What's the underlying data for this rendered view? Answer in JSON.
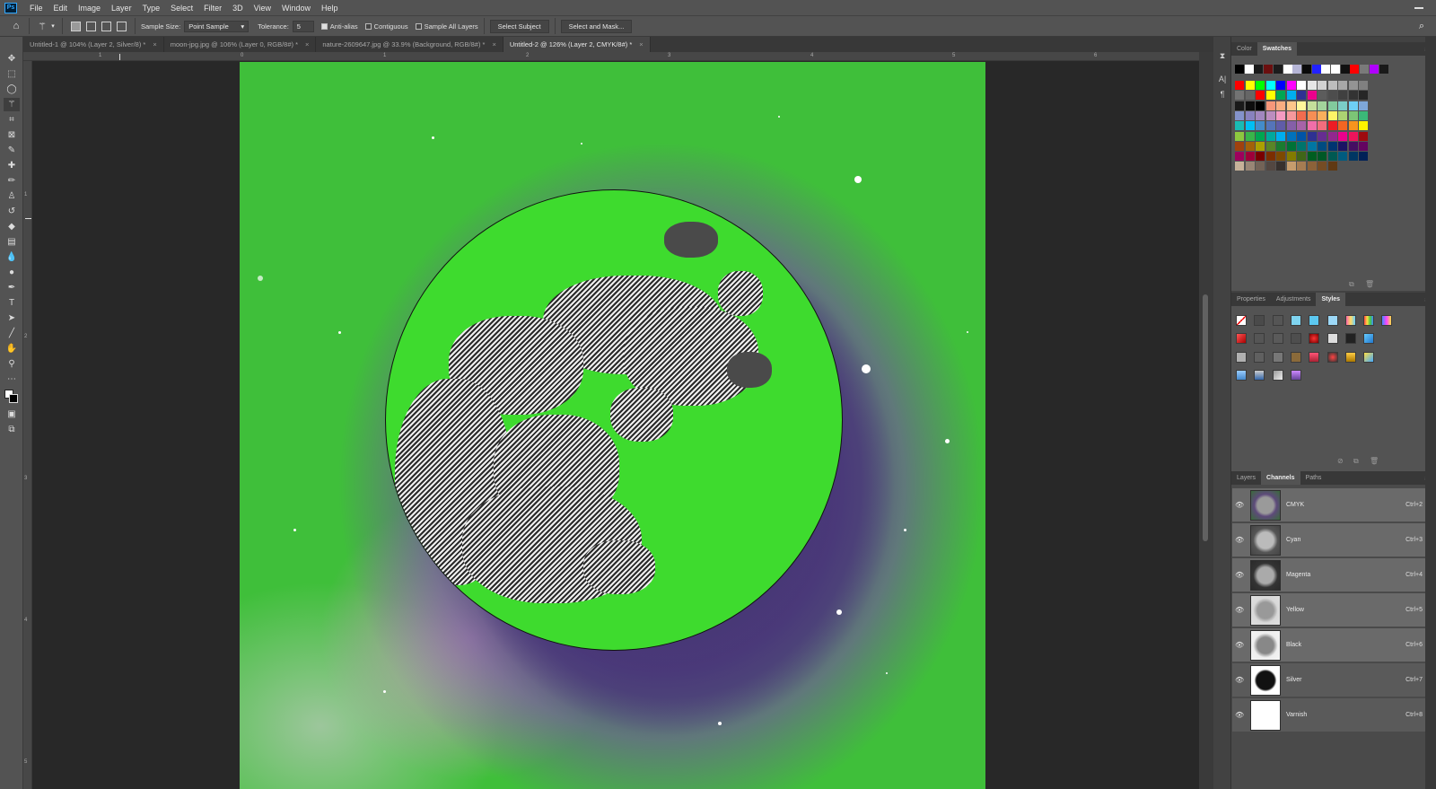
{
  "menu": {
    "logo": "Ps",
    "items": [
      "File",
      "Edit",
      "Image",
      "Layer",
      "Type",
      "Select",
      "Filter",
      "3D",
      "View",
      "Window",
      "Help"
    ]
  },
  "options": {
    "sample_size_label": "Sample Size:",
    "sample_size_value": "Point Sample",
    "tolerance_label": "Tolerance:",
    "tolerance_value": "5",
    "antialias_label": "Anti-alias",
    "contiguous_label": "Contiguous",
    "sample_all_label": "Sample All Layers",
    "select_subject": "Select Subject",
    "select_mask": "Select and Mask..."
  },
  "tabs": [
    {
      "label": "Untitled-1 @ 104% (Layer 2, Silver/8) *"
    },
    {
      "label": "moon-jpg.jpg @ 106% (Layer 0, RGB/8#) *"
    },
    {
      "label": "nature-2609647.jpg @ 33.9% (Background, RGB/8#) *"
    },
    {
      "label": "Untitled-2 @ 126% (Layer 2, CMYK/8#) *"
    }
  ],
  "ruler_h": [
    "1",
    "0",
    "1",
    "2",
    "3",
    "4",
    "5",
    "6"
  ],
  "ruler_v": [
    "1",
    "2",
    "3",
    "4",
    "5"
  ],
  "swatches_panel": {
    "tabs": [
      "Color",
      "Swatches"
    ],
    "active": "Swatches",
    "row1": [
      "#000000",
      "#ffffff",
      "#1a1a1a",
      "#6b0f0f",
      "#1c1c1c",
      "#ffffff",
      "#b5b5d6",
      "#0a0a0a",
      "#2222ff",
      "#ffffff",
      "#ffffff",
      "#111111",
      "#ff0000",
      "#7a7a7a",
      "#b000ff",
      "#1a1a1a"
    ],
    "colors": [
      [
        "#ff0000",
        "#ffff00",
        "#00ff00",
        "#00ffff",
        "#0000ff",
        "#ff00ff",
        "#ffffff",
        "#e6e6e6",
        "#d1d1d1",
        "#bdbdbd",
        "#a8a8a8",
        "#949494",
        "#808080"
      ],
      [
        "#737373",
        "#666666",
        "#ff0000",
        "#ffff00",
        "#00a651",
        "#00aeef",
        "#2e3192",
        "#ec008c",
        "#5c5c5c",
        "#4d4d4d",
        "#404040",
        "#333333",
        "#262626"
      ],
      [
        "#1a1a1a",
        "#0d0d0d",
        "#000000",
        "#f7977a",
        "#f9ad81",
        "#fdc68a",
        "#fff79a",
        "#c4df9b",
        "#a3d39c",
        "#82ca9d",
        "#7bcdc8",
        "#6ecff6",
        "#7ea7d8"
      ],
      [
        "#8493ca",
        "#8882be",
        "#a187be",
        "#bc8dbf",
        "#f49ac2",
        "#f6989d",
        "#f26c4f",
        "#f68e55",
        "#fbaf5c",
        "#fff467",
        "#acd372",
        "#7cc576",
        "#3bb878"
      ],
      [
        "#1abbb4",
        "#00bff3",
        "#438cca",
        "#5574b9",
        "#605ca8",
        "#855fa8",
        "#a763a8",
        "#f06ea9",
        "#f26d7d",
        "#ed1c24",
        "#f26522",
        "#f7941d",
        "#fff200"
      ],
      [
        "#8dc73f",
        "#39b54a",
        "#00a651",
        "#00a99d",
        "#00aeef",
        "#0072bc",
        "#0054a6",
        "#2e3192",
        "#662d91",
        "#92278f",
        "#ec008c",
        "#ed145b",
        "#9e0b0f"
      ],
      [
        "#a0410d",
        "#a36209",
        "#aba000",
        "#598527",
        "#1a7b30",
        "#007236",
        "#00746b",
        "#0076a3",
        "#004b80",
        "#003471",
        "#1b1464",
        "#440e62",
        "#630460"
      ],
      [
        "#9e005d",
        "#9e0039",
        "#790000",
        "#7b2e00",
        "#7d4900",
        "#827b00",
        "#406618",
        "#005e20",
        "#005826",
        "#005952",
        "#005b7f",
        "#003663",
        "#002157"
      ],
      [
        "#c7b299",
        "#998675",
        "#736357",
        "#534741",
        "#37302d",
        "#c69c6d",
        "#a67c52",
        "#8c6239",
        "#754c24",
        "#603913"
      ]
    ]
  },
  "styles_panel": {
    "tabs": [
      "Properties",
      "Adjustments",
      "Styles"
    ],
    "active": "Styles"
  },
  "channels_panel": {
    "tabs": [
      "Layers",
      "Channels",
      "Paths"
    ],
    "active": "Channels",
    "channels": [
      {
        "name": "CMYK",
        "shortcut": "Ctrl+2"
      },
      {
        "name": "Cyan",
        "shortcut": "Ctrl+3"
      },
      {
        "name": "Magenta",
        "shortcut": "Ctrl+4"
      },
      {
        "name": "Yellow",
        "shortcut": "Ctrl+5"
      },
      {
        "name": "Black",
        "shortcut": "Ctrl+6"
      },
      {
        "name": "Silver",
        "shortcut": "Ctrl+7"
      },
      {
        "name": "Varnish",
        "shortcut": "Ctrl+8"
      }
    ]
  },
  "colors": {
    "selection_fill": "#3edb2e",
    "background_green": "#3fbf3a"
  }
}
